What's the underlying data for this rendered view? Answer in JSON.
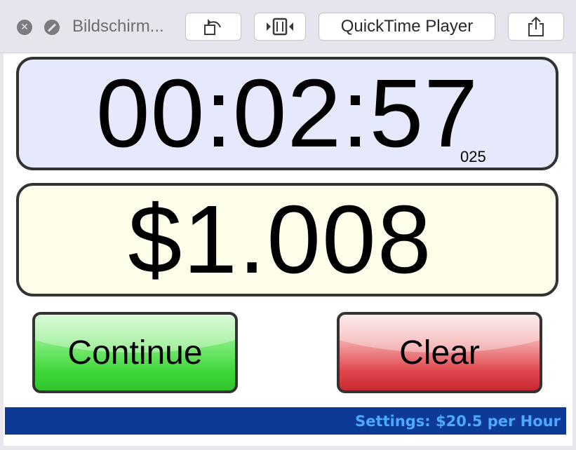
{
  "window": {
    "title": "Bildschirm...",
    "open_with_label": "QuickTime Player",
    "close_icon": "close-icon",
    "stop_icon": "stop-icon",
    "rotate_icon": "rotate-left-icon",
    "trim_icon": "trim-icon",
    "share_icon": "share-icon"
  },
  "timer": {
    "display": "00:02:57",
    "milliseconds": "025"
  },
  "cost": {
    "display": "$1.008"
  },
  "buttons": {
    "continue_label": "Continue",
    "clear_label": "Clear"
  },
  "settings": {
    "text": "Settings: $20.5 per Hour"
  },
  "colors": {
    "timer_panel_bg": "#e6e8fb",
    "cost_panel_bg": "#fdfde9",
    "continue_green": "#3fd63a",
    "clear_red": "#e0474d",
    "settings_bar_bg": "#0d3a97",
    "settings_text": "#4fa8ff"
  }
}
